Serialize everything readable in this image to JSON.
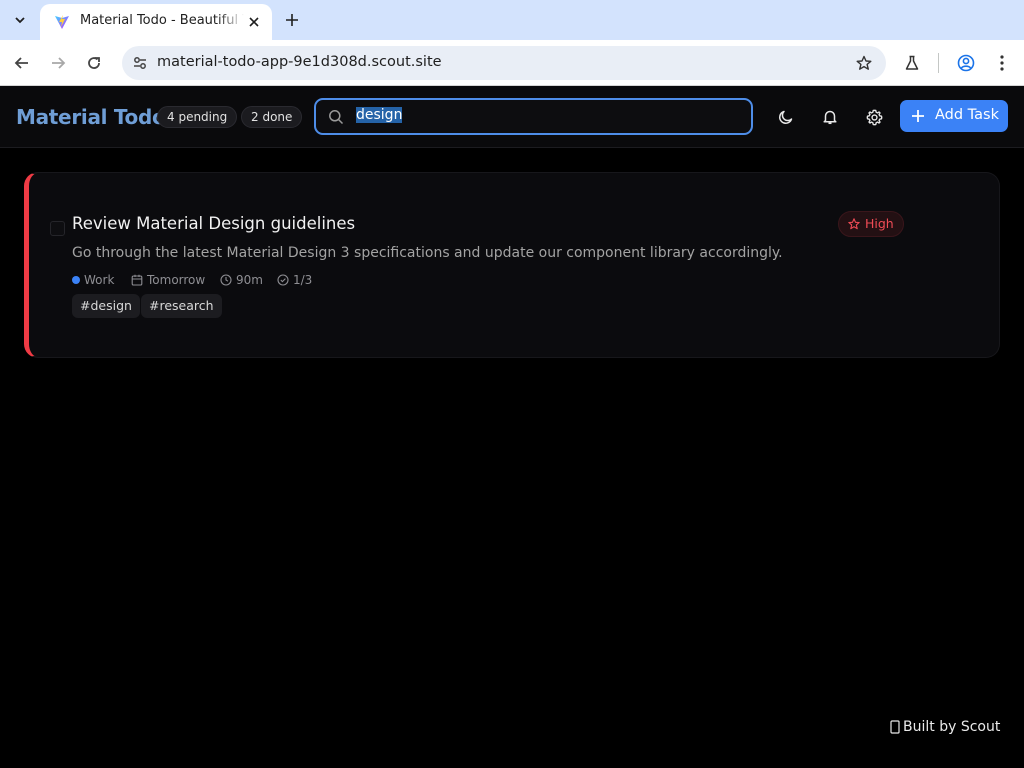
{
  "browser": {
    "tab": {
      "title": "Material Todo - Beautiful Task Manager"
    },
    "omnibox": {
      "url": "material-todo-app-9e1d308d.scout.site"
    }
  },
  "app": {
    "brand": "Material Todo",
    "stats": {
      "pending": "4 pending",
      "done": "2 done"
    },
    "search": {
      "value": "design"
    },
    "add_button": "Add Task"
  },
  "task": {
    "title": "Review Material Design guidelines",
    "description": "Go through the latest Material Design 3 specifications and update our component library accordingly.",
    "priority": "High",
    "category": "Work",
    "due": "Tomorrow",
    "duration": "90m",
    "subtasks": "1/3",
    "tags": [
      "#design",
      "#research"
    ]
  },
  "footer": {
    "built_by": "Built by Scout"
  },
  "colors": {
    "accent": "#3b82f6",
    "priority_high": "#ef3b45",
    "brand": "#6f9ed6"
  }
}
